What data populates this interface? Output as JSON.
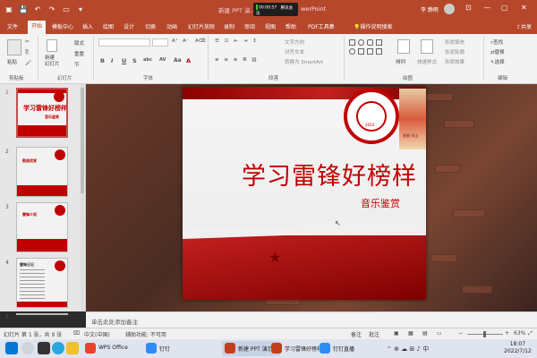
{
  "titlebar": {
    "title_prefix": "新建 PPT 演...",
    "title_suffix": "werPoint",
    "meeting_time": "00:00:57",
    "meeting_label": "腾讯会议",
    "user_name": "李 静雨",
    "quick_save": "💾",
    "quick_undo": "↶",
    "quick_redo": "↷"
  },
  "tabs": [
    "文件",
    "开始",
    "模板中心",
    "插入",
    "绘图",
    "设计",
    "切换",
    "动画",
    "幻灯片放映",
    "录制",
    "审阅",
    "视图",
    "帮助",
    "PDF工具集",
    "操作说明搜索"
  ],
  "share_label": "共享",
  "ribbon": {
    "paste": "粘贴",
    "clipboard": "剪贴板",
    "new_slide": "新建\n幻灯片",
    "reuse": "重用\n幻灯片",
    "layout": "版式",
    "reset": "重置",
    "section": "节",
    "slides": "幻灯片",
    "font_group": "字体",
    "para_group": "段落",
    "drawing_group": "绘图",
    "editing_group": "编辑",
    "text_dir": "文字方向",
    "align_text": "对齐文本",
    "smartart": "转换为 SmartArt",
    "arrange": "排列",
    "quick_styles": "快速样式",
    "fill": "形状填充",
    "outline": "形状轮廓",
    "effects": "形状效果",
    "find": "查找",
    "replace": "替换",
    "select": "选择",
    "bold": "B",
    "italic": "I",
    "underline": "U",
    "strike": "S",
    "shadow": "abc",
    "spacing": "AV"
  },
  "thumbnails": [
    {
      "num": "1",
      "title": "学习雷锋好榜样",
      "sub": "音乐鉴赏"
    },
    {
      "num": "2",
      "title": "歌曲欣赏",
      "sub": ""
    },
    {
      "num": "3",
      "title": "雷锋介绍",
      "sub": ""
    },
    {
      "num": "4",
      "title": "雷锋日记",
      "sub": ""
    },
    {
      "num": "5",
      "title": "",
      "sub": ""
    }
  ],
  "slide": {
    "title": "学习雷锋好榜样",
    "subtitle": "音乐鉴赏",
    "seal_year": "2003",
    "art_caption": "星星 河山"
  },
  "notes_placeholder": "单击此处添加备注",
  "status": {
    "slide_info": "幻灯片 第 1 张，共 9 张",
    "language": "中文(中国)",
    "accessibility": "辅助功能: 不可用",
    "notes": "备注",
    "comments": "批注",
    "zoom": "63%"
  },
  "taskbar": {
    "wps": "WPS Office",
    "dingtalk": "钉钉",
    "ppt": "新建 PPT 演示...",
    "ppt2": "学习雷锋好榜样...",
    "dingtalk2": "钉钉直播",
    "time": "18:07",
    "date": "2022/7/12"
  }
}
